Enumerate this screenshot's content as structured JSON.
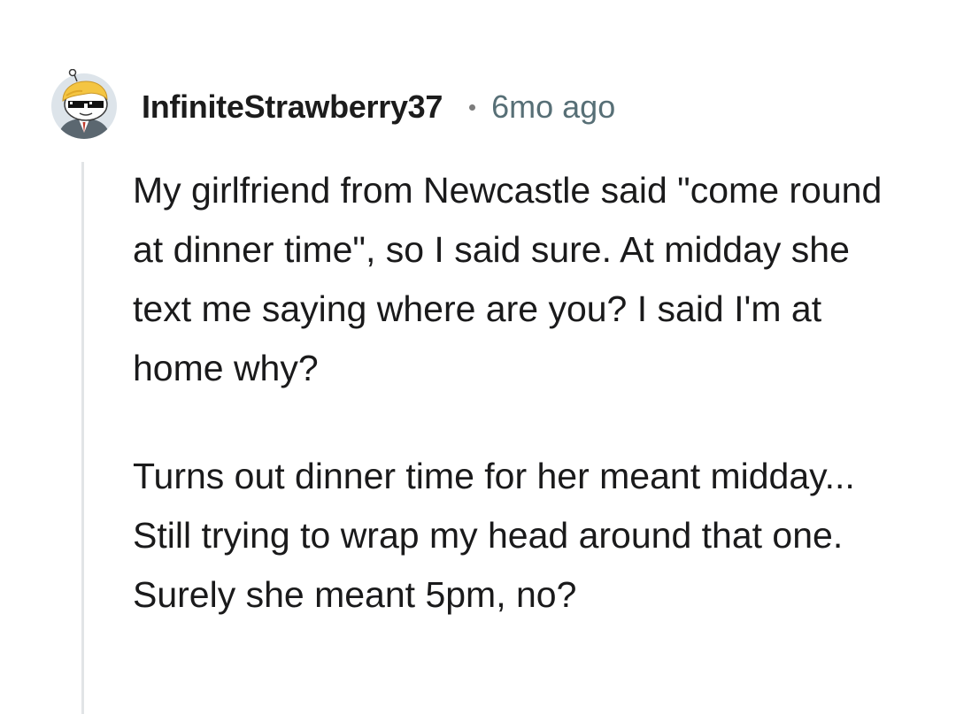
{
  "comment": {
    "author": {
      "username": "InfiniteStrawberry37",
      "avatar_icon": "snoo-avatar-sunglasses-icon"
    },
    "timestamp": "6mo ago",
    "separator": "•",
    "body": {
      "paragraphs": [
        "My girlfriend from Newcastle said \"come round at dinner time\", so I said sure. At midday she text me saying where are you? I said I'm at home why?",
        "Turns out dinner time for her meant midday... Still trying to wrap my head around that one. Surely she meant 5pm, no?"
      ]
    }
  },
  "colors": {
    "username": "#1c1c1c",
    "timestamp": "#576f76",
    "body_text": "#1a1a1b",
    "thread_line": "#e2e4e6",
    "background": "#ffffff"
  }
}
